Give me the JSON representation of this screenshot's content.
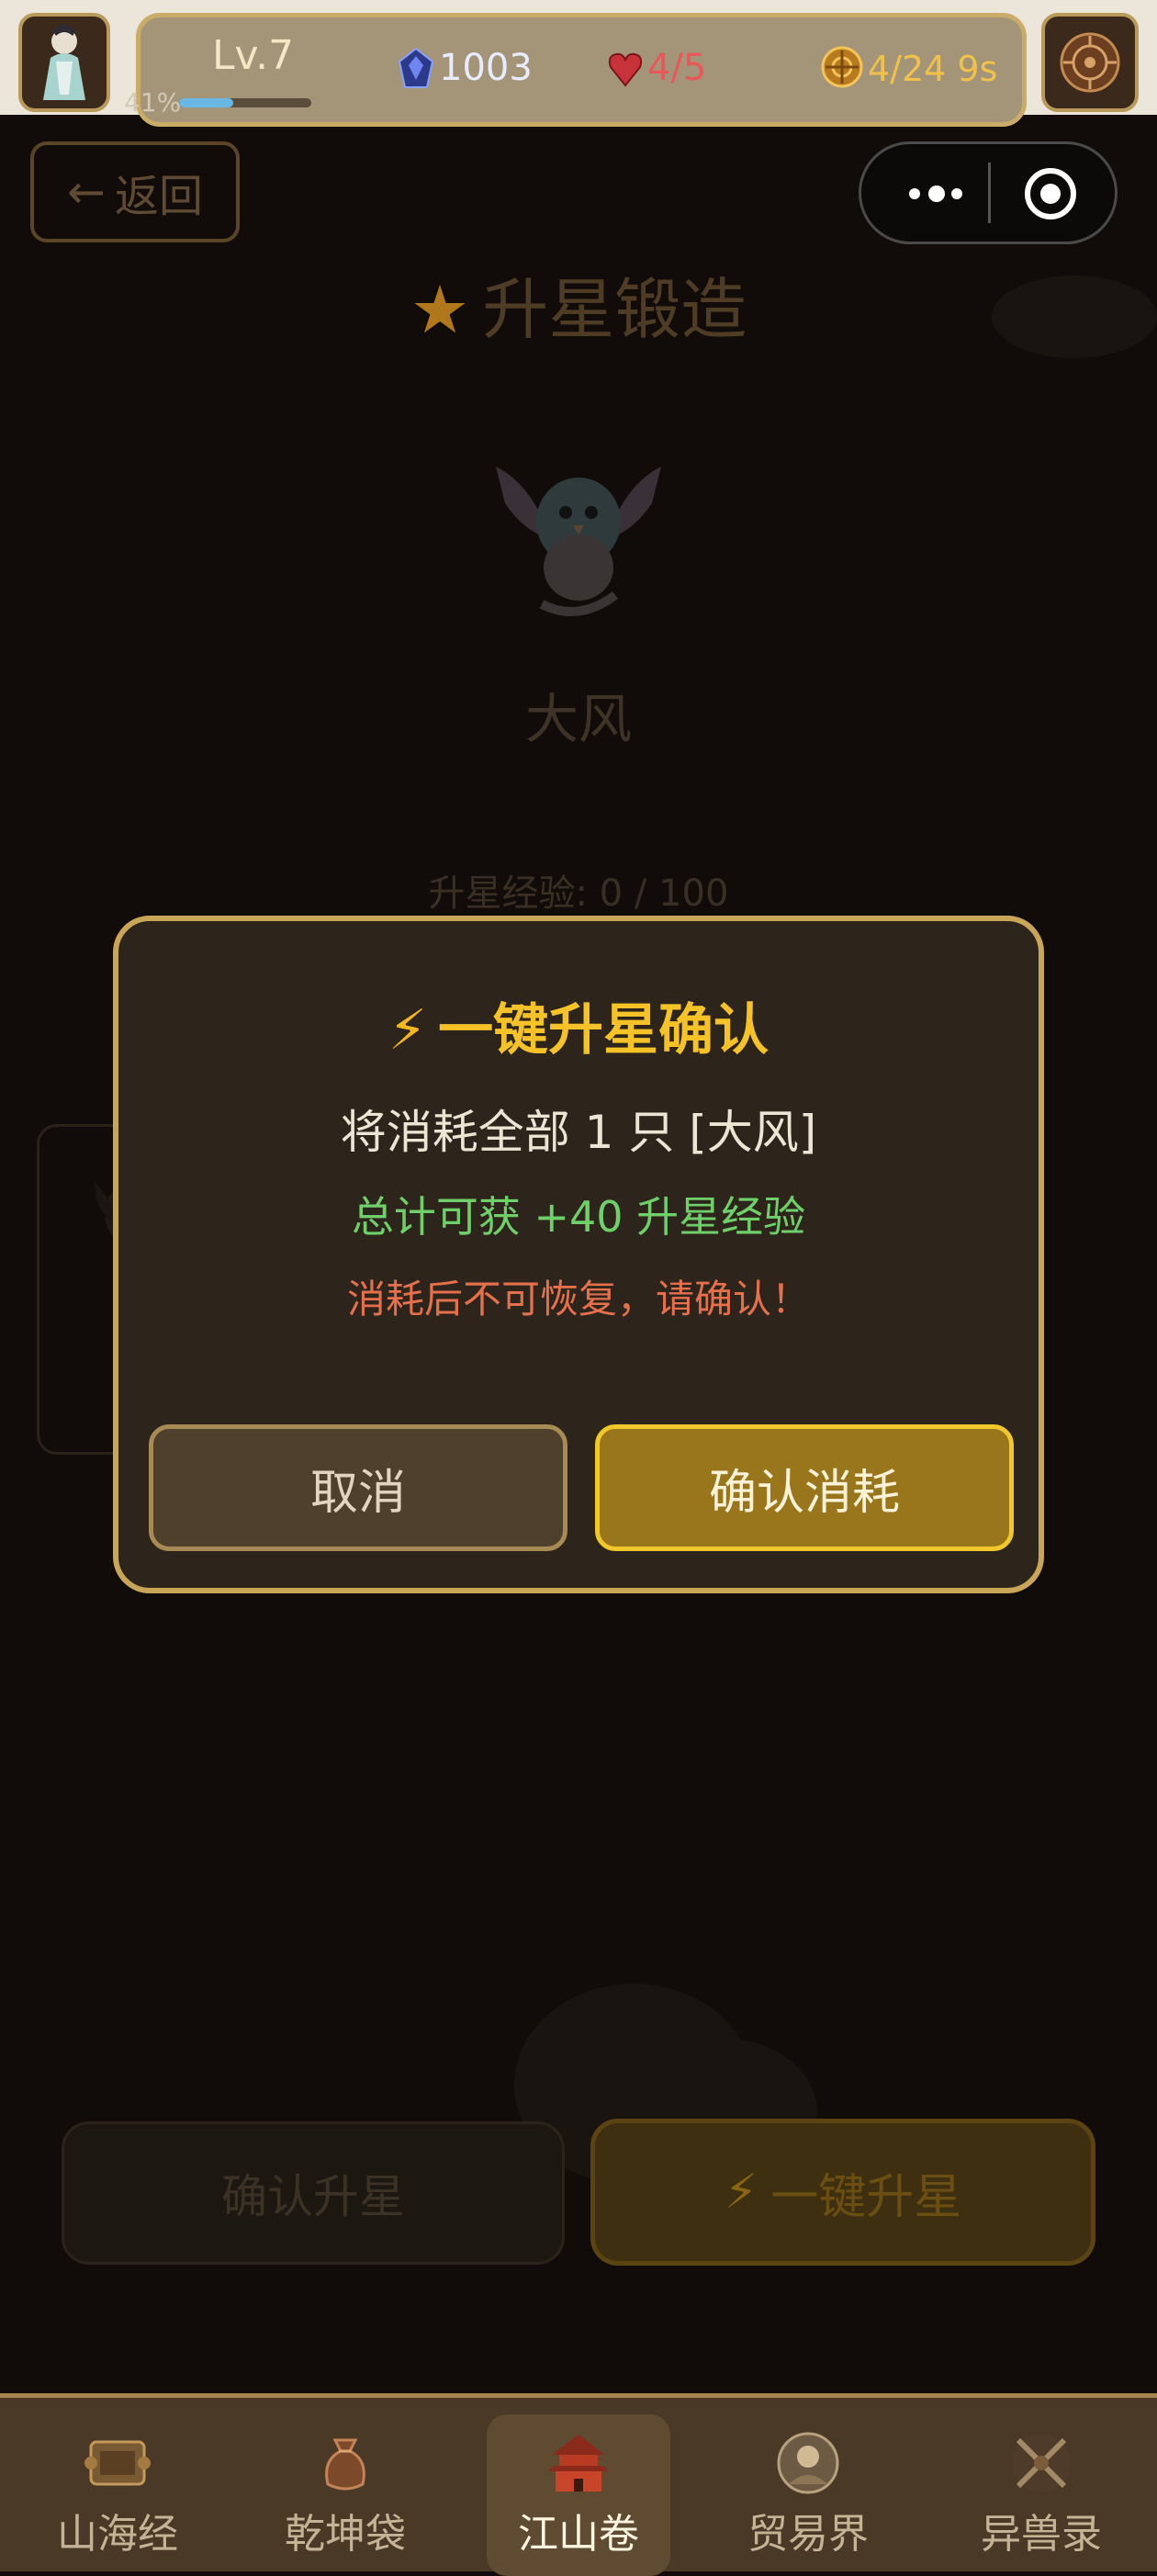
{
  "hud": {
    "level": "Lv.7",
    "exp_percent": "41%",
    "exp_fraction": 0.41,
    "gems": "1003",
    "stamina": "4/5",
    "coins": "4/24 9s",
    "colors": {
      "stamina": "#e8585a",
      "coins": "#f0c24a",
      "level": "#f4e7c4"
    }
  },
  "page": {
    "back_label": "返回",
    "title": "升星锻造",
    "beast_name": "大风",
    "exp_text": "升星经验: 0 / 100",
    "bottom_confirm": "确认升星",
    "bottom_one_click": "一键升星"
  },
  "modal": {
    "title": "一键升星确认",
    "line1": "将消耗全部 1 只 [大风]",
    "line2": "总计可获 +40 升星经验",
    "line3": "消耗后不可恢复，请确认！",
    "cancel": "取消",
    "confirm": "确认消耗"
  },
  "nav": {
    "items": [
      {
        "label": "山海经",
        "icon": "scroll-icon"
      },
      {
        "label": "乾坤袋",
        "icon": "bag-icon"
      },
      {
        "label": "江山卷",
        "icon": "palace-icon"
      },
      {
        "label": "贸易界",
        "icon": "merchant-icon"
      },
      {
        "label": "异兽录",
        "icon": "crossed-swords-icon"
      }
    ],
    "active_index": 2
  }
}
